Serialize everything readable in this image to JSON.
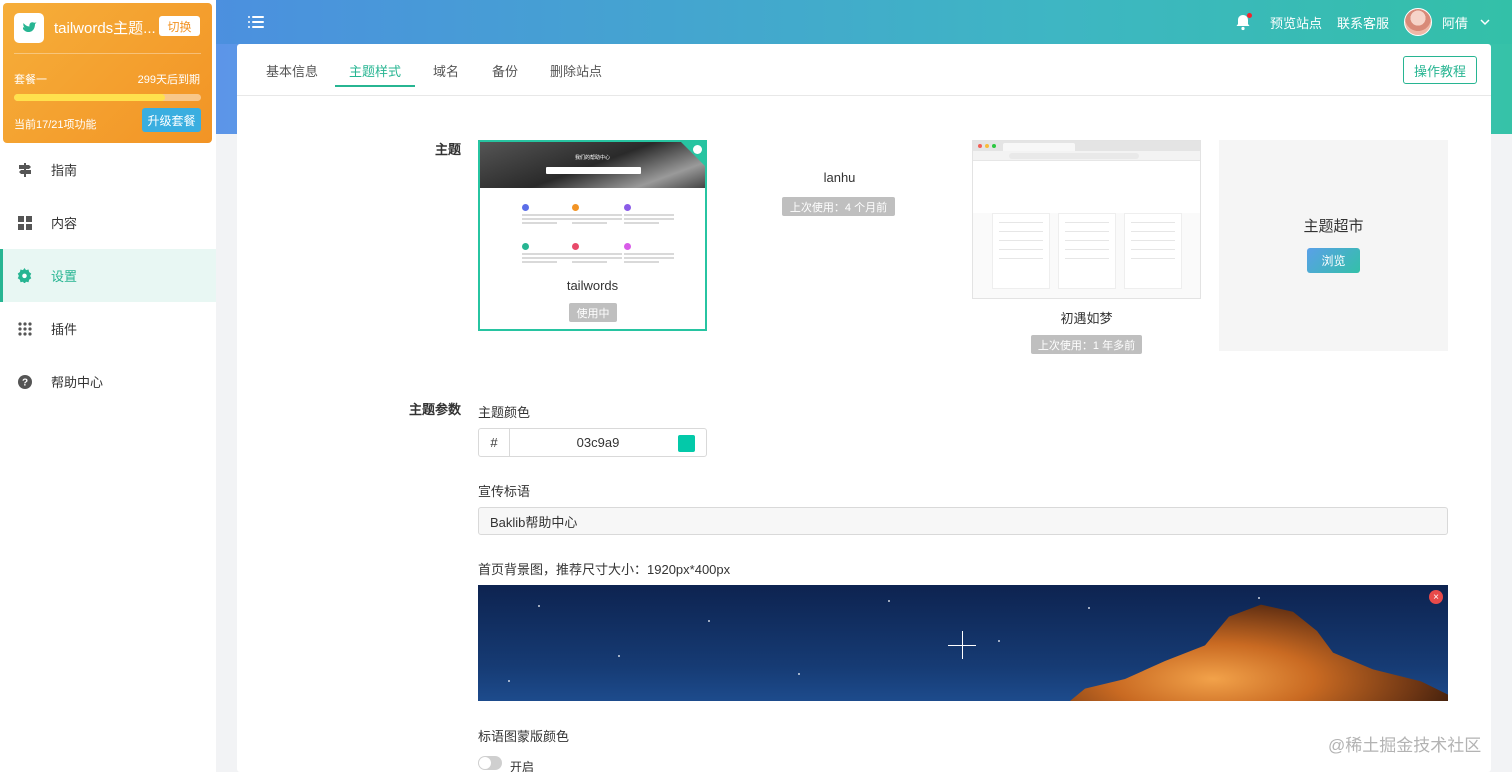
{
  "app": {
    "site_name": "tailwords主题...",
    "switch_label": "切换",
    "plan_name": "套餐一",
    "plan_expire": "299天后到期",
    "plan_progress": 0.81,
    "plan_features": "当前17/21项功能",
    "upgrade_label": "升级套餐"
  },
  "header": {
    "preview_site": "预览站点",
    "contact_support": "联系客服",
    "user_name": "阿倩"
  },
  "sidebar": {
    "items": [
      {
        "label": "指南",
        "icon": "signpost-icon",
        "active": false
      },
      {
        "label": "内容",
        "icon": "grid-icon",
        "active": false
      },
      {
        "label": "设置",
        "icon": "gear-icon",
        "active": true
      },
      {
        "label": "插件",
        "icon": "apps-icon",
        "active": false
      },
      {
        "label": "帮助中心",
        "icon": "help-icon",
        "active": false
      }
    ]
  },
  "tabs": {
    "items": [
      "基本信息",
      "主题样式",
      "域名",
      "备份",
      "删除站点"
    ],
    "active": "主题样式",
    "tutorial_label": "操作教程"
  },
  "theme_section": {
    "label": "主题",
    "themes": [
      {
        "name": "tailwords",
        "status": "使用中"
      },
      {
        "name": "lanhu",
        "status": "上次使用：4 个月前"
      },
      {
        "name": "初遇如梦",
        "status": "上次使用：1 年多前"
      }
    ],
    "market_title": "主题超市",
    "browse_label": "浏览",
    "preview_caption": "我们的帮助中心"
  },
  "params": {
    "label": "主题参数",
    "color_label": "主题颜色",
    "color_hash": "#",
    "color_value": "03c9a9",
    "color_hex": "#03c9a9",
    "slogan_label": "宣传标语",
    "slogan_value": "Baklib帮助中心",
    "bg_label": "首页背景图，推荐尺寸大小：1920px*400px",
    "overlay_label": "标语图蒙版颜色",
    "toggle_label": "开启",
    "toggle_on": false
  },
  "watermark": "@稀土掘金技术社区",
  "colors": {
    "accent": "#27b592",
    "plan_orange": "#f29425"
  }
}
